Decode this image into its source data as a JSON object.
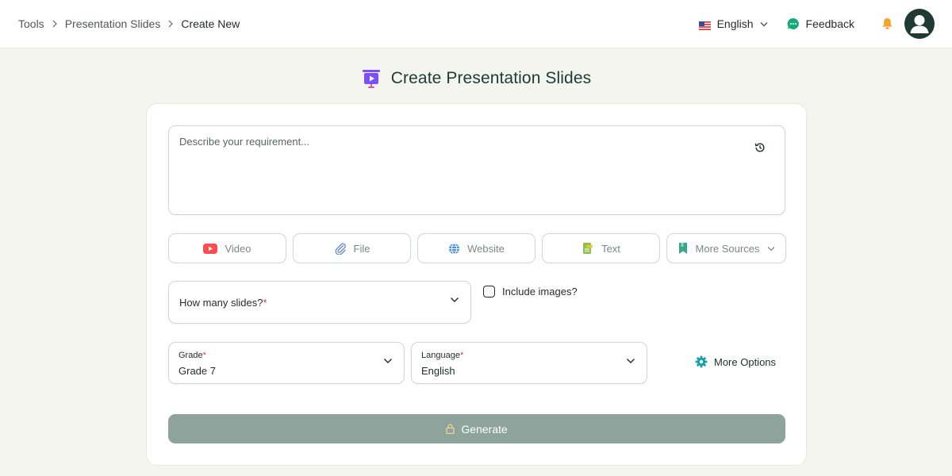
{
  "breadcrumb": {
    "items": [
      "Tools",
      "Presentation Slides"
    ],
    "current": "Create New"
  },
  "header": {
    "language": "English",
    "feedback": "Feedback"
  },
  "page": {
    "title": "Create Presentation Slides"
  },
  "form": {
    "requirement_placeholder": "Describe your requirement...",
    "sources": [
      {
        "label": "Video",
        "icon": "youtube-icon"
      },
      {
        "label": "File",
        "icon": "paperclip-icon"
      },
      {
        "label": "Website",
        "icon": "globe-icon"
      },
      {
        "label": "Text",
        "icon": "text-document-icon"
      },
      {
        "label": "More Sources",
        "icon": "bookmark-icon"
      }
    ],
    "slides_label": "How many slides?",
    "required_mark": "*",
    "include_images_label": "Include images?",
    "grade_label": "Grade",
    "grade_value": "Grade 7",
    "language_label": "Language",
    "language_value": "English",
    "more_options": "More Options",
    "generate": "Generate"
  },
  "colors": {
    "accent_dark": "#1e3a33",
    "generate_disabled": "#8da39c",
    "feedback_green": "#17a87a",
    "bell_orange": "#f5a524",
    "title_icon_purple": "#7b4dff",
    "youtube_red": "#ff4d4f"
  }
}
